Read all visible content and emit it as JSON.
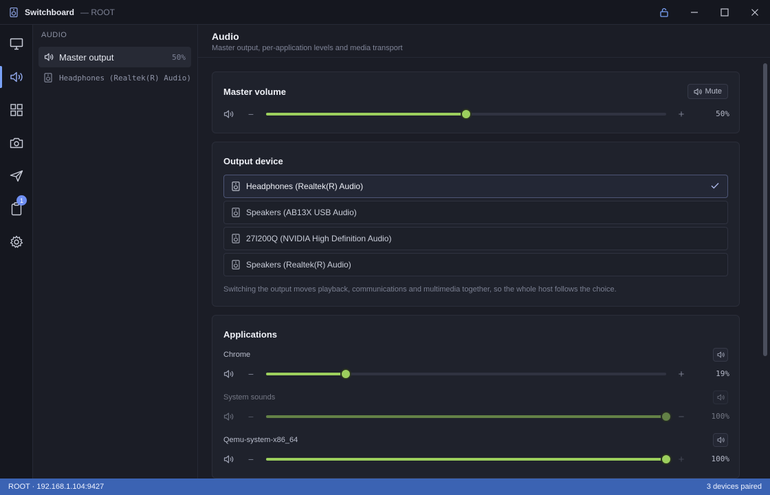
{
  "app": {
    "title": "Switchboard",
    "subtitle": "— ROOT"
  },
  "rail": {
    "items": [
      {
        "name": "display-icon"
      },
      {
        "name": "speaker-icon",
        "active": true
      },
      {
        "name": "grid-icon"
      },
      {
        "name": "camera-icon"
      },
      {
        "name": "send-icon"
      },
      {
        "name": "clipboard-icon",
        "badge": "1"
      },
      {
        "name": "gear-icon"
      }
    ]
  },
  "sidebar": {
    "heading": "AUDIO",
    "items": [
      {
        "label": "Master output",
        "value": "50%",
        "icon": "speaker-icon"
      },
      {
        "label": "Headphones (Realtek(R) Audio)",
        "icon": "speaker-device-icon"
      }
    ]
  },
  "page": {
    "title": "Audio",
    "subtitle": "Master output, per-application levels and media transport"
  },
  "master": {
    "title": "Master volume",
    "mute_label": "Mute",
    "level": 50,
    "pct": "50%"
  },
  "output": {
    "title": "Output device",
    "devices": [
      {
        "label": "Headphones (Realtek(R) Audio)",
        "selected": true
      },
      {
        "label": "Speakers (AB13X USB Audio)"
      },
      {
        "label": "27I200Q (NVIDIA High Definition Audio)"
      },
      {
        "label": "Speakers (Realtek(R) Audio)"
      }
    ],
    "note": "Switching the output moves playback, communications and multimedia together, so the whole host follows the choice."
  },
  "applications": {
    "title": "Applications",
    "apps": [
      {
        "name": "Chrome",
        "level": 20,
        "pct": "19%",
        "dim": false
      },
      {
        "name": "System sounds",
        "level": 100,
        "pct": "100%",
        "dim": true
      },
      {
        "name": "Qemu-system-x86_64",
        "level": 100,
        "pct": "100%",
        "dim": false
      }
    ]
  },
  "status": {
    "left": "ROOT · 192.168.1.104:9427",
    "right": "3 devices paired"
  },
  "colors": {
    "accent": "#9ccf5d",
    "status_bar": "#3b63b3",
    "selection": "#7aa2f7"
  }
}
